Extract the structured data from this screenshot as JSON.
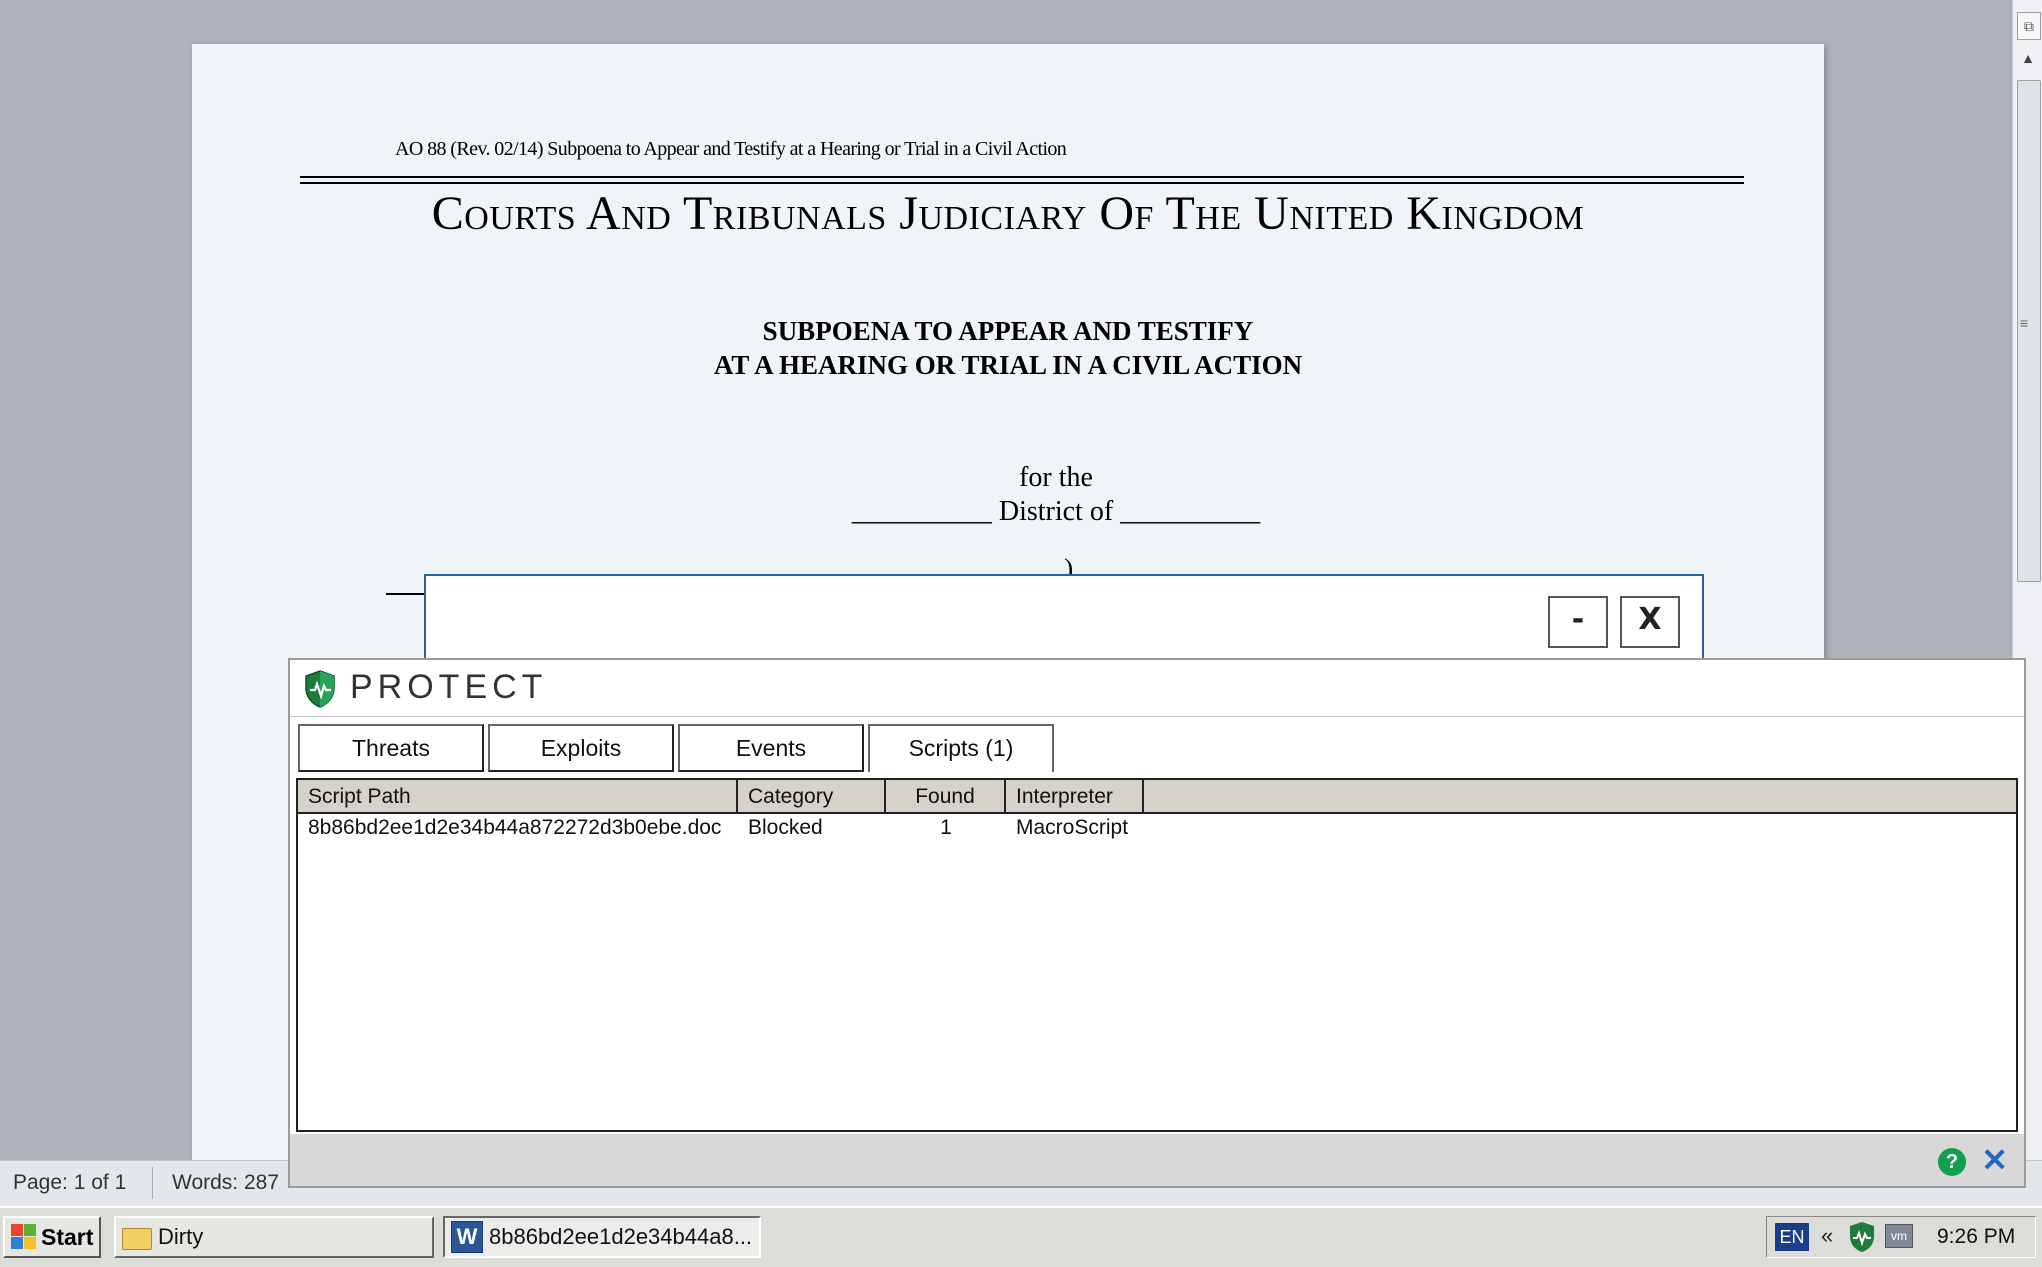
{
  "document": {
    "form_code": "AO 88 (Rev. 02/14) Subpoena to Appear and Testify at a Hearing or Trial in a Civil Action",
    "court_name": "Courts And Tribunals Judiciary Of The United Kingdom",
    "subpoena_line1": "SUBPOENA TO APPEAR AND TESTIFY",
    "subpoena_line2": "AT A HEARING OR TRIAL IN A CIVIL ACTION",
    "for_the": "for the",
    "district": "__________ District of __________",
    "paren": ")"
  },
  "popup": {
    "minimize_label": "-",
    "close_label": "X"
  },
  "protect": {
    "brand": "PROTECT",
    "tabs": [
      {
        "label": "Threats"
      },
      {
        "label": "Exploits"
      },
      {
        "label": "Events"
      },
      {
        "label": "Scripts (1)"
      }
    ],
    "active_tab": "Scripts (1)",
    "columns": [
      "Script Path",
      "Category",
      "Found",
      "Interpreter"
    ],
    "rows": [
      {
        "script_path": "8b86bd2ee1d2e34b44a872272d3b0ebe.doc",
        "category": "Blocked",
        "found": "1",
        "interpreter": "MacroScript"
      }
    ],
    "help_label": "?",
    "close_label": "✕"
  },
  "status_bar": {
    "page": "Page: 1 of 1",
    "words": "Words: 287"
  },
  "taskbar": {
    "start_label": "Start",
    "tasks": [
      {
        "label": "Dirty",
        "icon": "folder-icon"
      },
      {
        "label": "8b86bd2ee1d2e34b44a8...",
        "icon": "word-icon"
      }
    ],
    "language": "EN",
    "tray_expand": "«",
    "clock": "9:26 PM"
  },
  "colors": {
    "shield_green": "#13a04a",
    "close_blue": "#2167c4",
    "popup_border": "#2c5faa"
  }
}
